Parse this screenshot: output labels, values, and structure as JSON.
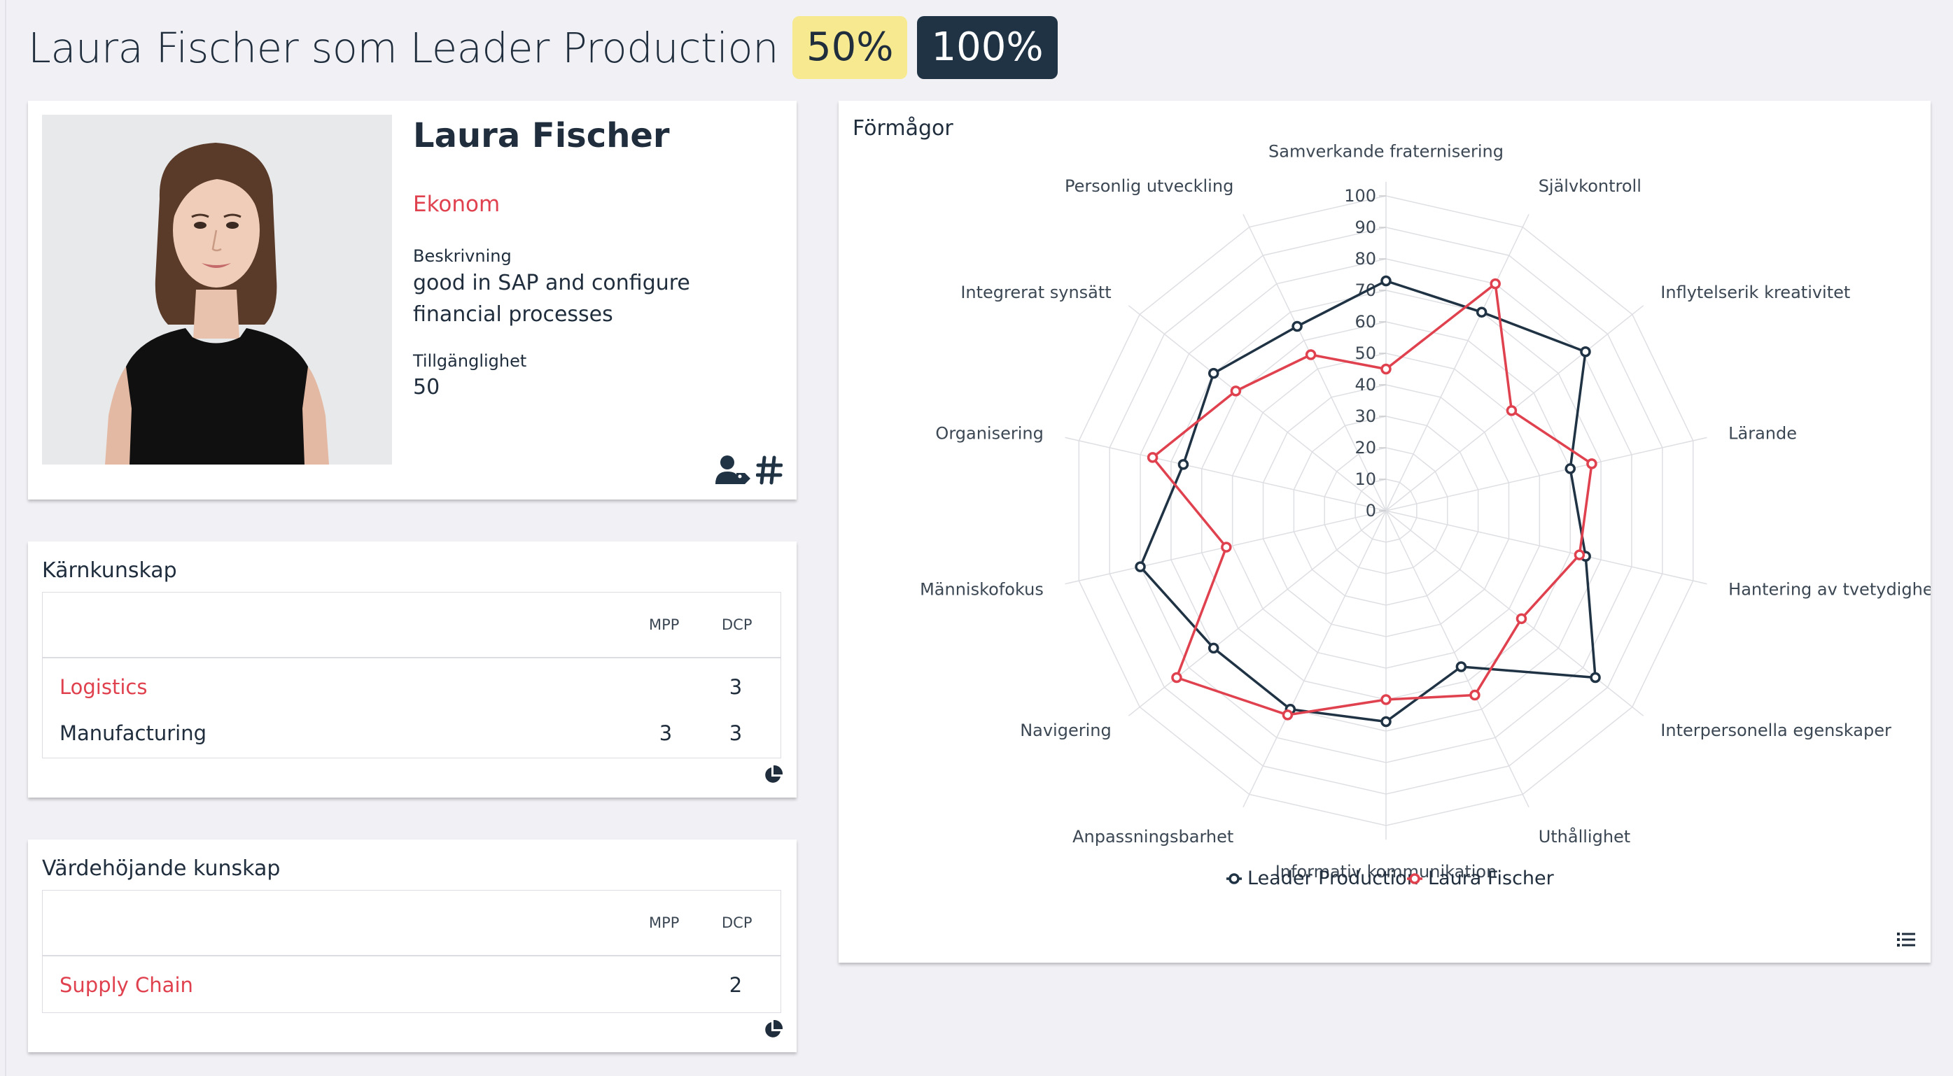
{
  "header": {
    "title": "Laura Fischer som Leader Production",
    "badge_match": "50%",
    "badge_full": "100%"
  },
  "profile": {
    "name": "Laura Fischer",
    "role": "Ekonom",
    "description_label": "Beskrivning",
    "description": "good in SAP and configure financial processes",
    "availability_label": "Tillgänglighet",
    "availability": "50",
    "icons": [
      "user-tag-icon",
      "hashtag-icon"
    ]
  },
  "core_skills": {
    "title": "Kärnkunskap",
    "columns": [
      "MPP",
      "DCP"
    ],
    "rows": [
      {
        "name": "Logistics",
        "mpp": "",
        "dcp": "3",
        "highlight": true
      },
      {
        "name": "Manufacturing",
        "mpp": "3",
        "dcp": "3",
        "highlight": false
      }
    ],
    "icon": "pie-chart-icon"
  },
  "value_skills": {
    "title": "Värdehöjande kunskap",
    "columns": [
      "MPP",
      "DCP"
    ],
    "rows": [
      {
        "name": "Supply Chain",
        "mpp": "",
        "dcp": "2",
        "highlight": true
      }
    ],
    "icon": "pie-chart-icon"
  },
  "radar": {
    "title": "Förmågor",
    "icon": "list-icon"
  },
  "colors": {
    "accent_red": "#e0414e",
    "navy": "#1f3345",
    "badge_yellow": "#f7e98f"
  },
  "chart_data": {
    "type": "radar",
    "title": "",
    "axes": [
      "Samverkande fraternisering",
      "Självkontroll",
      "Inflytelserik kreativitet",
      "Lärande",
      "Hantering av tvetydighet",
      "Interpersonella egenskaper",
      "Uthållighet",
      "Informativ kommunikation",
      "Anpassningsbarhet",
      "Navigering",
      "Människofokus",
      "Organisering",
      "Integrerat synsätt",
      "Personlig utveckling"
    ],
    "ticks": [
      0,
      10,
      20,
      30,
      40,
      50,
      60,
      70,
      80,
      90,
      100
    ],
    "range": [
      0,
      100
    ],
    "legend_position": "bottom",
    "series": [
      {
        "name": "Leader Production",
        "color": "#1f3345",
        "values": [
          73,
          70,
          81,
          60,
          65,
          85,
          55,
          67,
          70,
          70,
          80,
          66,
          70,
          65
        ]
      },
      {
        "name": "Laura Fischer",
        "color": "#e0414e",
        "values": [
          45,
          80,
          51,
          67,
          63,
          55,
          65,
          60,
          72,
          85,
          52,
          76,
          61,
          55
        ]
      }
    ]
  }
}
